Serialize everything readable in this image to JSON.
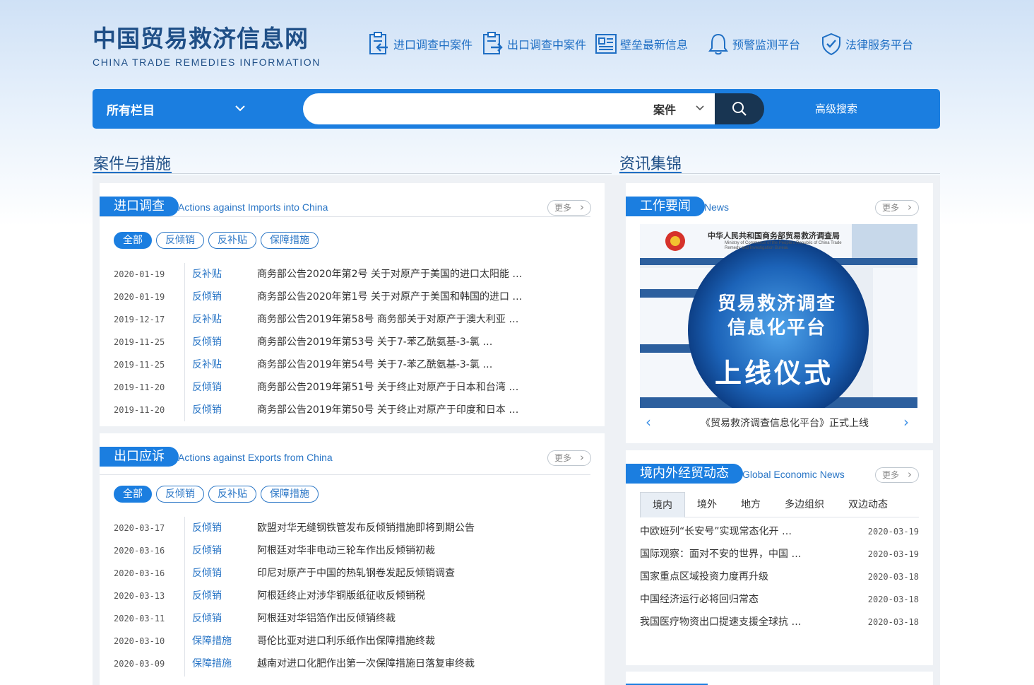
{
  "site": {
    "logo_cn": "中国贸易救济信息网",
    "logo_en": "CHINA TRADE REMEDIES INFORMATION",
    "top_links": [
      {
        "label": "进口调查中案件",
        "icon": "import-case-icon"
      },
      {
        "label": "出口调查中案件",
        "icon": "export-case-icon"
      },
      {
        "label": "壁垒最新信息",
        "icon": "news-icon"
      },
      {
        "label": "预警监测平台",
        "icon": "bell-icon"
      },
      {
        "label": "法律服务平台",
        "icon": "shield-check-icon"
      }
    ]
  },
  "search": {
    "category": "所有栏目",
    "placeholder": "",
    "type": "案件",
    "advanced": "高级搜索"
  },
  "colors": {
    "accent": "#1b7ee0",
    "dark": "#183552",
    "title": "#1f4f87"
  },
  "sections": {
    "cases_title": "案件与措施",
    "news_title": "资讯集锦"
  },
  "imports": {
    "tag": "进口调查",
    "en": "Actions against Imports into China",
    "more": "更多",
    "filters": [
      "全部",
      "反倾销",
      "反补贴",
      "保障措施"
    ],
    "rows": [
      {
        "date": "2020-01-19",
        "type": "反补贴",
        "title": "商务部公告2020年第2号 关于对原产于美国的进口太阳能 …"
      },
      {
        "date": "2020-01-19",
        "type": "反倾销",
        "title": "商务部公告2020年第1号 关于对原产于美国和韩国的进口 …"
      },
      {
        "date": "2019-12-17",
        "type": "反补贴",
        "title": "商务部公告2019年第58号 商务部关于对原产于澳大利亚 …"
      },
      {
        "date": "2019-11-25",
        "type": "反倾销",
        "title": "商务部公告2019年第53号 关于7-苯乙酰氨基-3-氯 …"
      },
      {
        "date": "2019-11-25",
        "type": "反补贴",
        "title": "商务部公告2019年第54号 关于7-苯乙酰氨基-3-氯 …"
      },
      {
        "date": "2019-11-20",
        "type": "反倾销",
        "title": "商务部公告2019年第51号 关于终止对原产于日本和台湾 …"
      },
      {
        "date": "2019-11-20",
        "type": "反倾销",
        "title": "商务部公告2019年第50号 关于终止对原产于印度和日本 …"
      }
    ]
  },
  "exports": {
    "tag": "出口应诉",
    "en": "Actions against Exports from China",
    "more": "更多",
    "filters": [
      "全部",
      "反倾销",
      "反补贴",
      "保障措施"
    ],
    "rows": [
      {
        "date": "2020-03-17",
        "type": "反倾销",
        "title": "欧盟对华无缝钢铁管发布反倾销措施即将到期公告"
      },
      {
        "date": "2020-03-16",
        "type": "反倾销",
        "title": "阿根廷对华非电动三轮车作出反倾销初裁"
      },
      {
        "date": "2020-03-16",
        "type": "反倾销",
        "title": "印尼对原产于中国的热轧钢卷发起反倾销调查"
      },
      {
        "date": "2020-03-13",
        "type": "反倾销",
        "title": "阿根廷终止对涉华铜版纸征收反倾销税"
      },
      {
        "date": "2020-03-11",
        "type": "反倾销",
        "title": "阿根廷对华铝箔作出反倾销终裁"
      },
      {
        "date": "2020-03-10",
        "type": "保障措施",
        "title": "哥伦比亚对进口利乐纸作出保障措施终裁"
      },
      {
        "date": "2020-03-09",
        "type": "保障措施",
        "title": "越南对进口化肥作出第一次保障措施日落复审终裁"
      }
    ]
  },
  "work_news": {
    "tag": "工作要闻",
    "en": "News",
    "more": "更多",
    "slide_caption": "《贸易救济调查信息化平台》正式上线",
    "image_header": "中华人民共和国商务部贸易救济调查局",
    "image_header_en": "Ministry of Commerce of the People's Republic of China Trade Remedy and Investigation Bureau",
    "image_line1": "贸易救济调查",
    "image_line2": "信息化平台",
    "image_line3": "上线仪式"
  },
  "global_news": {
    "tag": "境内外经贸动态",
    "en": "Global Economic News",
    "more": "更多",
    "tabs": [
      "境内",
      "境外",
      "地方",
      "多边组织",
      "双边动态"
    ],
    "rows": [
      {
        "title": "中欧班列“长安号”实现常态化开 …",
        "date": "2020-03-19"
      },
      {
        "title": "国际观察：面对不安的世界，中国 …",
        "date": "2020-03-19"
      },
      {
        "title": "国家重点区域投资力度再升级",
        "date": "2020-03-18"
      },
      {
        "title": "中国经济运行必将回归常态",
        "date": "2020-03-18"
      },
      {
        "title": "我国医疗物资出口提速支援全球抗 …",
        "date": "2020-03-18"
      }
    ]
  }
}
